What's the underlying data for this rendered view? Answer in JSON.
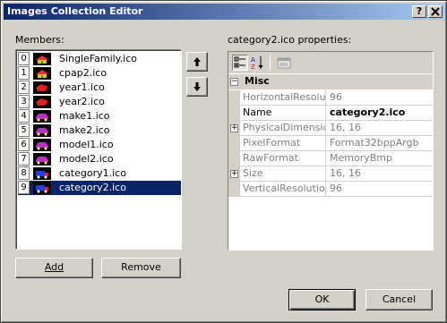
{
  "window": {
    "title": "Images Collection Editor",
    "help_label": "?",
    "close_label": "X"
  },
  "members": {
    "label": "Members:",
    "items": [
      {
        "index": "0",
        "name": "SingleFamily.ico",
        "icon": "house-icon"
      },
      {
        "index": "1",
        "name": "cpap2.ico",
        "icon": "house-icon"
      },
      {
        "index": "2",
        "name": "year1.ico",
        "icon": "shape-icon"
      },
      {
        "index": "3",
        "name": "year2.ico",
        "icon": "shape-icon"
      },
      {
        "index": "4",
        "name": "make1.ico",
        "icon": "car-icon"
      },
      {
        "index": "5",
        "name": "make2.ico",
        "icon": "car-icon"
      },
      {
        "index": "6",
        "name": "model1.ico",
        "icon": "car-icon"
      },
      {
        "index": "7",
        "name": "model2.ico",
        "icon": "car-icon"
      },
      {
        "index": "8",
        "name": "category1.ico",
        "icon": "truck-icon"
      },
      {
        "index": "9",
        "name": "category2.ico",
        "icon": "truck-icon"
      }
    ],
    "selected_index": 9
  },
  "order_buttons": {
    "up_icon": "arrow-up-icon",
    "down_icon": "arrow-down-icon"
  },
  "add_button": "Add",
  "remove_button": "Remove",
  "properties": {
    "label": "category2.ico properties:",
    "toolbar": [
      "categorized-icon",
      "alphabetical-icon",
      "property-pages-icon"
    ],
    "category": "Misc",
    "rows": [
      {
        "name": "HorizontalResolution",
        "value": "96",
        "expandable": false,
        "editable": false
      },
      {
        "name": "Name",
        "value": "category2.ico",
        "expandable": false,
        "editable": true
      },
      {
        "name": "PhysicalDimension",
        "value": "16, 16",
        "expandable": true,
        "editable": false
      },
      {
        "name": "PixelFormat",
        "value": "Format32bppArgb",
        "expandable": false,
        "editable": false
      },
      {
        "name": "RawFormat",
        "value": "MemoryBmp",
        "expandable": false,
        "editable": false
      },
      {
        "name": "Size",
        "value": "16, 16",
        "expandable": true,
        "editable": false
      },
      {
        "name": "VerticalResolution",
        "value": "96",
        "expandable": false,
        "editable": false
      }
    ]
  },
  "ok_button": "OK",
  "cancel_button": "Cancel",
  "colors": {
    "title_active": "#0a246a",
    "selection": "#0a246a",
    "face": "#d4d0c8"
  }
}
